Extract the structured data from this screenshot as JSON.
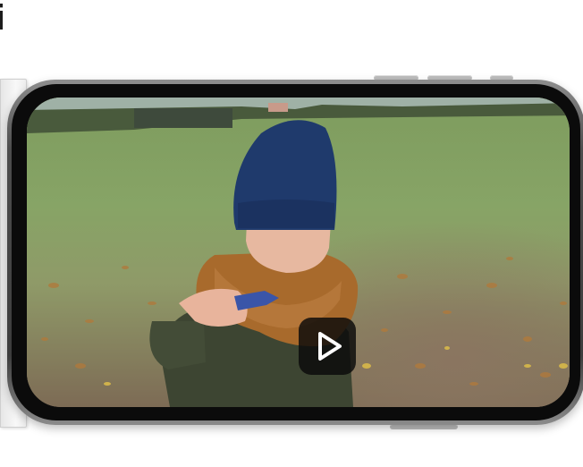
{
  "page": {
    "heading_fragment": "i"
  },
  "video": {
    "icons": {
      "play": "play-icon"
    }
  },
  "colors": {
    "phone_frame": "#3d3d3d",
    "play_button_bg": "#0a0a0a",
    "play_icon": "#ffffff"
  }
}
